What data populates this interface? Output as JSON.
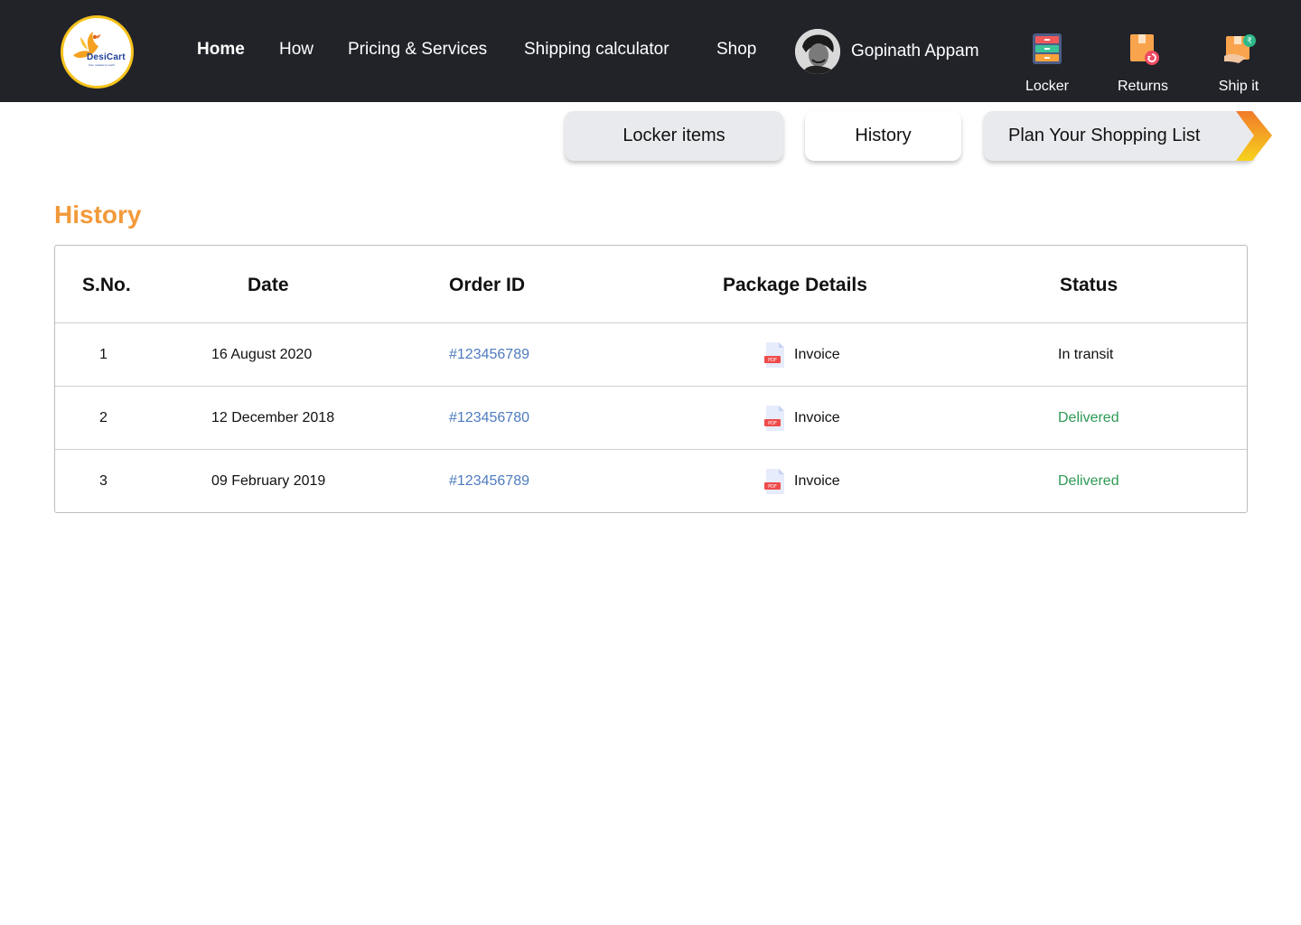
{
  "brand": {
    "name": "DesiCart",
    "tagline": "from markets to world"
  },
  "nav": {
    "links": [
      {
        "label": "Home",
        "active": true
      },
      {
        "label": "How"
      },
      {
        "label": "Pricing & Services"
      },
      {
        "label": "Shipping calculator"
      },
      {
        "label": "Shop"
      }
    ],
    "user_name": "Gopinath Appam",
    "quick_actions": [
      {
        "label": "Locker",
        "icon": "locker-icon"
      },
      {
        "label": "Returns",
        "icon": "returns-icon"
      },
      {
        "label": "Ship it",
        "icon": "ship-it-icon"
      }
    ]
  },
  "tabs": {
    "locker_items": "Locker items",
    "history": "History",
    "plan": "Plan Your Shopping List"
  },
  "history": {
    "title": "History",
    "columns": [
      "S.No.",
      "Date",
      "Order ID",
      "Package Details",
      "Status"
    ],
    "rows": [
      {
        "sno": "1",
        "date": "16 August 2020",
        "order_id": "#123456789",
        "package": "Invoice",
        "status": "In transit"
      },
      {
        "sno": "2",
        "date": "12 December 2018",
        "order_id": "#123456780",
        "package": "Invoice",
        "status": "Delivered"
      },
      {
        "sno": "3",
        "date": "09 February 2019",
        "order_id": "#123456789",
        "package": "Invoice",
        "status": "Delivered"
      }
    ]
  },
  "colors": {
    "navbar": "#212329",
    "accent_orange": "#f29a3b",
    "link_blue": "#4e7bbf",
    "delivered_green": "#2e9a55",
    "logo_ring": "#f6c21a"
  }
}
